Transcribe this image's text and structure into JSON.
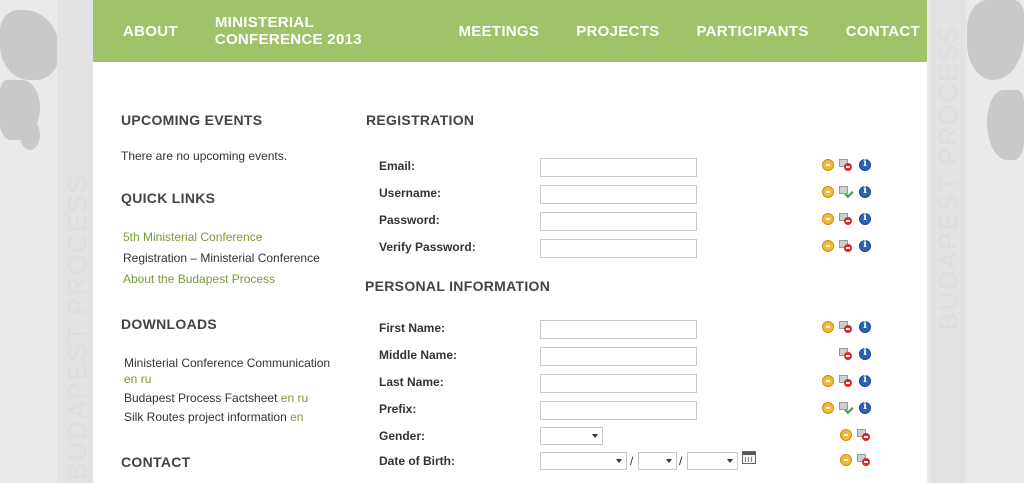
{
  "rail": {
    "text": "BUDAPEST PROCESS"
  },
  "nav": {
    "items": [
      "ABOUT",
      "MINISTERIAL CONFERENCE 2013",
      "MEETINGS",
      "PROJECTS",
      "PARTICIPANTS",
      "CONTACT"
    ]
  },
  "sidebar": {
    "upcoming_title": "UPCOMING EVENTS",
    "upcoming_text": "There are no upcoming events.",
    "quick_title": "QUICK LINKS",
    "quick_links": [
      "5th Ministerial Conference",
      "Registration – Ministerial Conference",
      "About the Budapest Process"
    ],
    "downloads_title": "DOWNLOADS",
    "downloads": [
      {
        "text": "Ministerial Conference Communication",
        "en": "en",
        "ru": "ru"
      },
      {
        "text": "Budapest Process Factsheet",
        "en": "en",
        "ru": "ru"
      },
      {
        "text": "Silk Routes project information",
        "en": "en"
      }
    ],
    "contact_title": "CONTACT"
  },
  "registration": {
    "title": "REGISTRATION",
    "fields": [
      {
        "label": "Email:",
        "value": ""
      },
      {
        "label": "Username:",
        "value": ""
      },
      {
        "label": "Password:",
        "value": ""
      },
      {
        "label": "Verify Password:",
        "value": ""
      }
    ]
  },
  "personal": {
    "title": "PERSONAL INFORMATION",
    "fields": [
      {
        "label": "First Name:",
        "value": ""
      },
      {
        "label": "Middle Name:",
        "value": ""
      },
      {
        "label": "Last Name:",
        "value": ""
      },
      {
        "label": "Prefix:",
        "value": ""
      }
    ],
    "gender_label": "Gender:",
    "dob_label": "Date of Birth:",
    "dob_sep": "/"
  },
  "colors": {
    "nav_bg": "#a0c36a",
    "link": "#7a9a3a"
  }
}
